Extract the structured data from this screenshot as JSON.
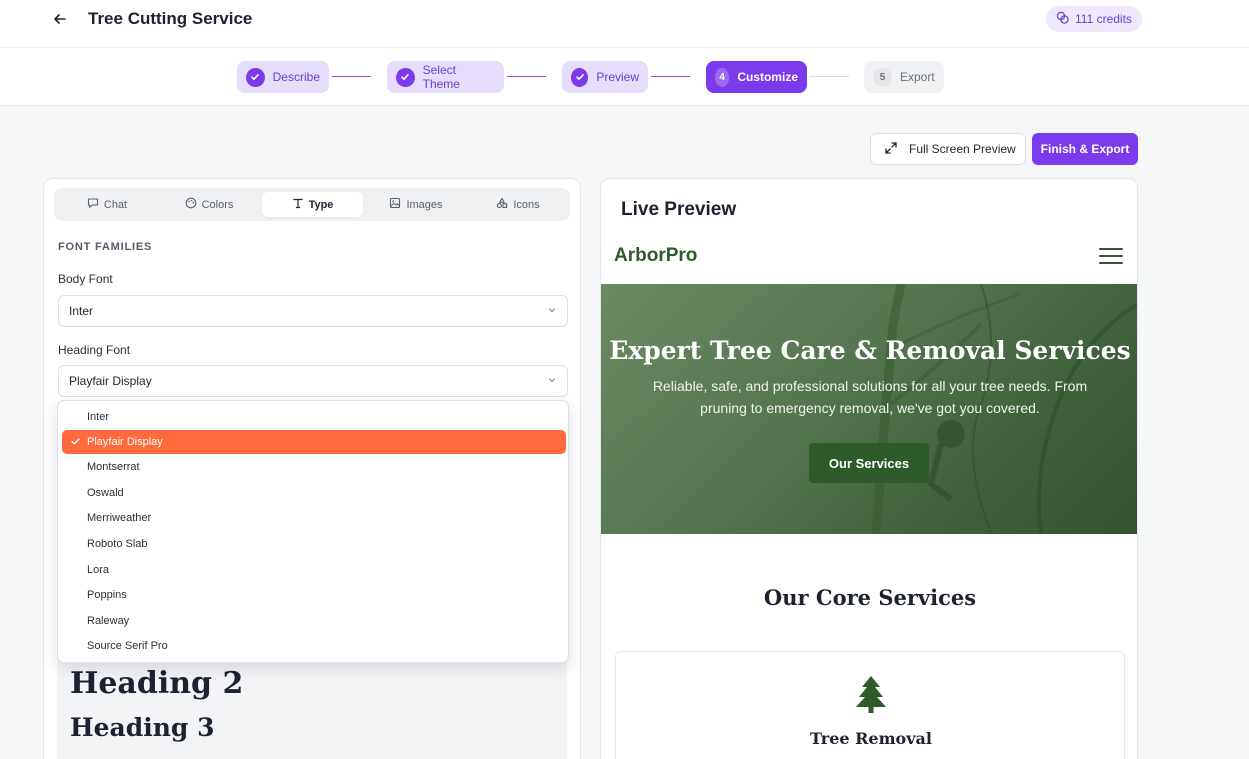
{
  "header": {
    "title": "Tree Cutting Service",
    "credits": "111 credits"
  },
  "steps": [
    {
      "num": "",
      "label": "Describe",
      "state": "done"
    },
    {
      "num": "",
      "label": "Select Theme",
      "state": "done"
    },
    {
      "num": "",
      "label": "Preview",
      "state": "done"
    },
    {
      "num": "4",
      "label": "Customize",
      "state": "active"
    },
    {
      "num": "5",
      "label": "Export",
      "state": "todo"
    }
  ],
  "actions": {
    "full_screen": "Full Screen Preview",
    "finish_export": "Finish & Export"
  },
  "tabs": [
    {
      "label": "Chat",
      "icon": "chat-icon"
    },
    {
      "label": "Colors",
      "icon": "palette-icon"
    },
    {
      "label": "Type",
      "icon": "type-icon",
      "active": true
    },
    {
      "label": "Images",
      "icon": "image-icon"
    },
    {
      "label": "Icons",
      "icon": "shapes-icon"
    }
  ],
  "fonts": {
    "section_title": "FONT FAMILIES",
    "body_label": "Body Font",
    "body_value": "Inter",
    "heading_label": "Heading Font",
    "heading_value": "Playfair Display",
    "options": [
      "Inter",
      "Playfair Display",
      "Montserrat",
      "Oswald",
      "Merriweather",
      "Roboto Slab",
      "Lora",
      "Poppins",
      "Raleway",
      "Source Serif Pro"
    ],
    "selected": "Playfair Display"
  },
  "samples": {
    "h2": "Heading 2",
    "h3": "Heading 3"
  },
  "preview": {
    "title": "Live Preview",
    "brand": "ArborPro",
    "hero_title": "Expert Tree Care & Removal Services",
    "hero_sub": "Reliable, safe, and professional solutions for all your tree needs. From pruning to emergency removal, we've got you covered.",
    "hero_button": "Our Services",
    "core_title": "Our Core Services",
    "service_name": "Tree Removal"
  },
  "colors": {
    "accent": "#7c3aed",
    "selected_option": "#ff6a3d",
    "brand_green": "#2f5a2a"
  }
}
